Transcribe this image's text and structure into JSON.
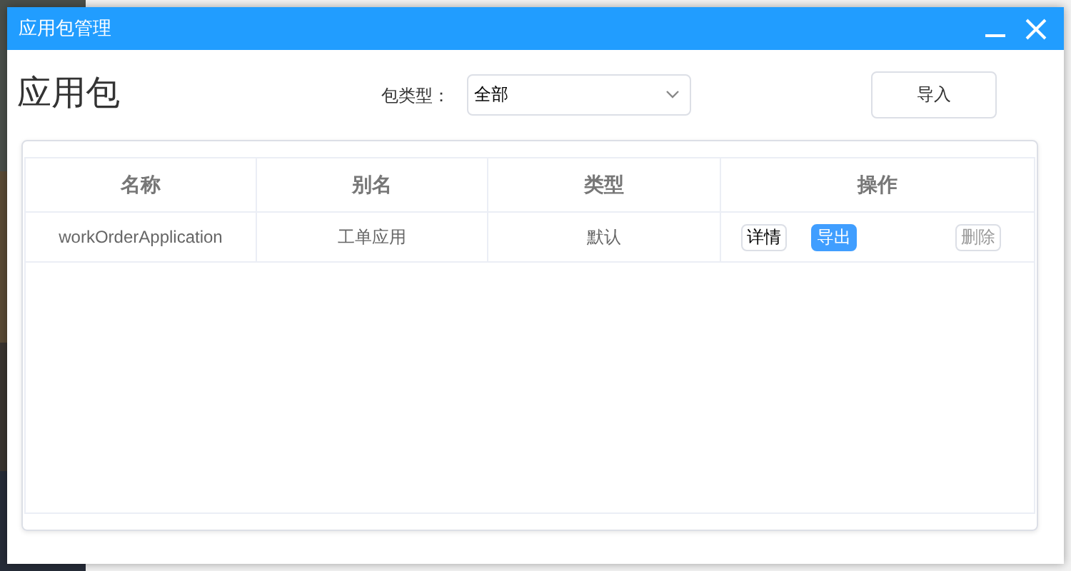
{
  "window": {
    "title": "应用包管理"
  },
  "heading": "应用包",
  "filter": {
    "label": "包类型：",
    "value": "全部"
  },
  "import_button": "导入",
  "table": {
    "columns": [
      "名称",
      "别名",
      "类型",
      "操作"
    ],
    "rows": [
      {
        "cells": [
          "workOrderApplication",
          "工单应用",
          "默认"
        ],
        "actions": [
          {
            "label": "详情",
            "kind": "plain"
          },
          {
            "label": "导出",
            "kind": "primary"
          },
          {
            "label": "删除",
            "kind": "muted"
          }
        ]
      }
    ]
  }
}
